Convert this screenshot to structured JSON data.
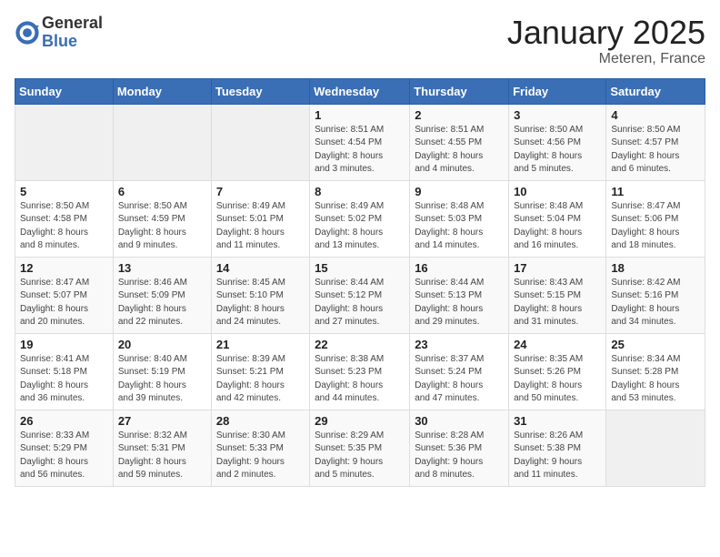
{
  "header": {
    "logo_general": "General",
    "logo_blue": "Blue",
    "month_title": "January 2025",
    "location": "Meteren, France"
  },
  "weekdays": [
    "Sunday",
    "Monday",
    "Tuesday",
    "Wednesday",
    "Thursday",
    "Friday",
    "Saturday"
  ],
  "weeks": [
    [
      {
        "day": "",
        "info": ""
      },
      {
        "day": "",
        "info": ""
      },
      {
        "day": "",
        "info": ""
      },
      {
        "day": "1",
        "info": "Sunrise: 8:51 AM\nSunset: 4:54 PM\nDaylight: 8 hours\nand 3 minutes."
      },
      {
        "day": "2",
        "info": "Sunrise: 8:51 AM\nSunset: 4:55 PM\nDaylight: 8 hours\nand 4 minutes."
      },
      {
        "day": "3",
        "info": "Sunrise: 8:50 AM\nSunset: 4:56 PM\nDaylight: 8 hours\nand 5 minutes."
      },
      {
        "day": "4",
        "info": "Sunrise: 8:50 AM\nSunset: 4:57 PM\nDaylight: 8 hours\nand 6 minutes."
      }
    ],
    [
      {
        "day": "5",
        "info": "Sunrise: 8:50 AM\nSunset: 4:58 PM\nDaylight: 8 hours\nand 8 minutes."
      },
      {
        "day": "6",
        "info": "Sunrise: 8:50 AM\nSunset: 4:59 PM\nDaylight: 8 hours\nand 9 minutes."
      },
      {
        "day": "7",
        "info": "Sunrise: 8:49 AM\nSunset: 5:01 PM\nDaylight: 8 hours\nand 11 minutes."
      },
      {
        "day": "8",
        "info": "Sunrise: 8:49 AM\nSunset: 5:02 PM\nDaylight: 8 hours\nand 13 minutes."
      },
      {
        "day": "9",
        "info": "Sunrise: 8:48 AM\nSunset: 5:03 PM\nDaylight: 8 hours\nand 14 minutes."
      },
      {
        "day": "10",
        "info": "Sunrise: 8:48 AM\nSunset: 5:04 PM\nDaylight: 8 hours\nand 16 minutes."
      },
      {
        "day": "11",
        "info": "Sunrise: 8:47 AM\nSunset: 5:06 PM\nDaylight: 8 hours\nand 18 minutes."
      }
    ],
    [
      {
        "day": "12",
        "info": "Sunrise: 8:47 AM\nSunset: 5:07 PM\nDaylight: 8 hours\nand 20 minutes."
      },
      {
        "day": "13",
        "info": "Sunrise: 8:46 AM\nSunset: 5:09 PM\nDaylight: 8 hours\nand 22 minutes."
      },
      {
        "day": "14",
        "info": "Sunrise: 8:45 AM\nSunset: 5:10 PM\nDaylight: 8 hours\nand 24 minutes."
      },
      {
        "day": "15",
        "info": "Sunrise: 8:44 AM\nSunset: 5:12 PM\nDaylight: 8 hours\nand 27 minutes."
      },
      {
        "day": "16",
        "info": "Sunrise: 8:44 AM\nSunset: 5:13 PM\nDaylight: 8 hours\nand 29 minutes."
      },
      {
        "day": "17",
        "info": "Sunrise: 8:43 AM\nSunset: 5:15 PM\nDaylight: 8 hours\nand 31 minutes."
      },
      {
        "day": "18",
        "info": "Sunrise: 8:42 AM\nSunset: 5:16 PM\nDaylight: 8 hours\nand 34 minutes."
      }
    ],
    [
      {
        "day": "19",
        "info": "Sunrise: 8:41 AM\nSunset: 5:18 PM\nDaylight: 8 hours\nand 36 minutes."
      },
      {
        "day": "20",
        "info": "Sunrise: 8:40 AM\nSunset: 5:19 PM\nDaylight: 8 hours\nand 39 minutes."
      },
      {
        "day": "21",
        "info": "Sunrise: 8:39 AM\nSunset: 5:21 PM\nDaylight: 8 hours\nand 42 minutes."
      },
      {
        "day": "22",
        "info": "Sunrise: 8:38 AM\nSunset: 5:23 PM\nDaylight: 8 hours\nand 44 minutes."
      },
      {
        "day": "23",
        "info": "Sunrise: 8:37 AM\nSunset: 5:24 PM\nDaylight: 8 hours\nand 47 minutes."
      },
      {
        "day": "24",
        "info": "Sunrise: 8:35 AM\nSunset: 5:26 PM\nDaylight: 8 hours\nand 50 minutes."
      },
      {
        "day": "25",
        "info": "Sunrise: 8:34 AM\nSunset: 5:28 PM\nDaylight: 8 hours\nand 53 minutes."
      }
    ],
    [
      {
        "day": "26",
        "info": "Sunrise: 8:33 AM\nSunset: 5:29 PM\nDaylight: 8 hours\nand 56 minutes."
      },
      {
        "day": "27",
        "info": "Sunrise: 8:32 AM\nSunset: 5:31 PM\nDaylight: 8 hours\nand 59 minutes."
      },
      {
        "day": "28",
        "info": "Sunrise: 8:30 AM\nSunset: 5:33 PM\nDaylight: 9 hours\nand 2 minutes."
      },
      {
        "day": "29",
        "info": "Sunrise: 8:29 AM\nSunset: 5:35 PM\nDaylight: 9 hours\nand 5 minutes."
      },
      {
        "day": "30",
        "info": "Sunrise: 8:28 AM\nSunset: 5:36 PM\nDaylight: 9 hours\nand 8 minutes."
      },
      {
        "day": "31",
        "info": "Sunrise: 8:26 AM\nSunset: 5:38 PM\nDaylight: 9 hours\nand 11 minutes."
      },
      {
        "day": "",
        "info": ""
      }
    ]
  ]
}
